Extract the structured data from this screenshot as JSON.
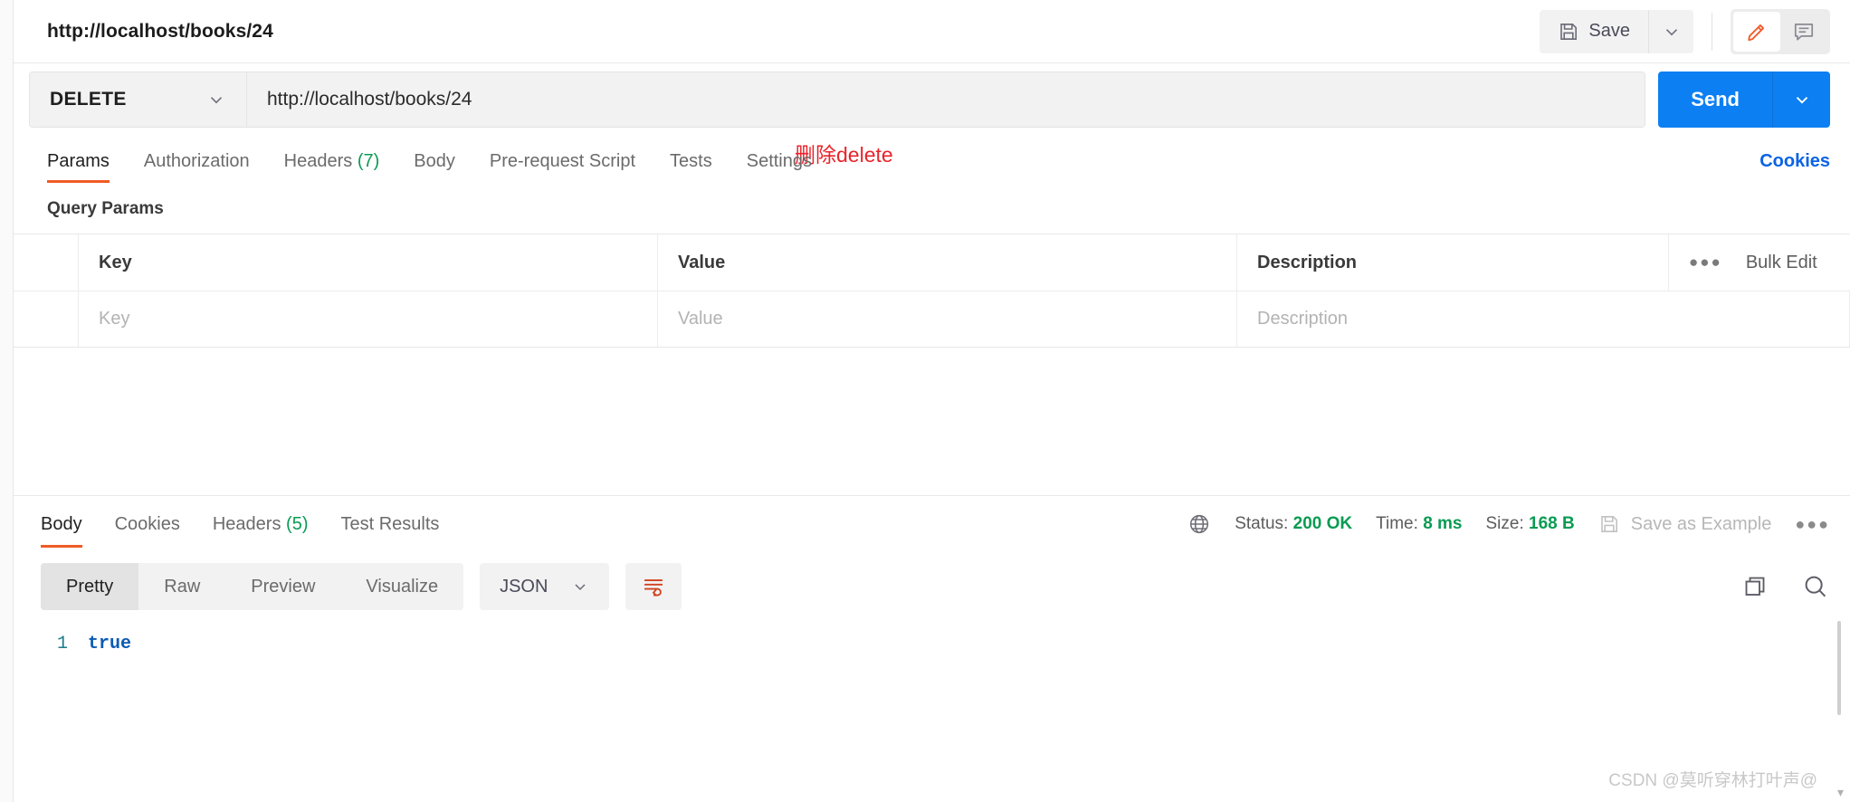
{
  "header": {
    "request_title": "http://localhost/books/24",
    "save_label": "Save",
    "save_caret_icon": "chevron-down-icon",
    "save_icon": "floppy-disk-icon",
    "edit_icon": "pencil-icon",
    "comment_icon": "comment-icon"
  },
  "request": {
    "method": "DELETE",
    "method_caret_icon": "chevron-down-icon",
    "url": "http://localhost/books/24",
    "send_label": "Send",
    "send_caret_icon": "chevron-down-icon",
    "annotation": "删除delete",
    "annotation_color": "#e8232a"
  },
  "request_tabs": {
    "items": [
      {
        "label": "Params",
        "count": "",
        "active": true
      },
      {
        "label": "Authorization",
        "count": "",
        "active": false
      },
      {
        "label": "Headers",
        "count": "(7)",
        "active": false
      },
      {
        "label": "Body",
        "count": "",
        "active": false
      },
      {
        "label": "Pre-request Script",
        "count": "",
        "active": false
      },
      {
        "label": "Tests",
        "count": "",
        "active": false
      },
      {
        "label": "Settings",
        "count": "",
        "active": false
      }
    ],
    "cookies_label": "Cookies",
    "cookies_color": "#0b63e5"
  },
  "query_params": {
    "section_title": "Query Params",
    "columns": [
      "Key",
      "Value",
      "Description"
    ],
    "bulk_edit_label": "Bulk Edit",
    "more_icon": "ellipsis-icon",
    "rows": [
      {
        "key": "Key",
        "value": "Value",
        "description": "Description"
      }
    ]
  },
  "response_tabs": {
    "items": [
      {
        "label": "Body",
        "count": "",
        "active": true
      },
      {
        "label": "Cookies",
        "count": "",
        "active": false
      },
      {
        "label": "Headers",
        "count": "(5)",
        "active": false
      },
      {
        "label": "Test Results",
        "count": "",
        "active": false
      }
    ]
  },
  "response_meta": {
    "globe_icon": "globe-icon",
    "status_label": "Status:",
    "status_value": "200 OK",
    "time_label": "Time:",
    "time_value": "8 ms",
    "size_label": "Size:",
    "size_value": "168 B",
    "save_as_example_label": "Save as Example",
    "save_as_example_icon": "floppy-disk-icon",
    "more_icon": "ellipsis-icon",
    "ok_color": "#0a9b53"
  },
  "body_toolbar": {
    "views": [
      {
        "label": "Pretty",
        "active": true
      },
      {
        "label": "Raw",
        "active": false
      },
      {
        "label": "Preview",
        "active": false
      },
      {
        "label": "Visualize",
        "active": false
      }
    ],
    "format": "JSON",
    "format_caret_icon": "chevron-down-icon",
    "wrap_icon": "word-wrap-icon",
    "copy_icon": "copy-icon",
    "search_icon": "search-icon"
  },
  "response_body": {
    "lines": [
      {
        "number": "1",
        "text": "true"
      }
    ]
  },
  "watermark": "CSDN @莫听穿林打叶声@"
}
